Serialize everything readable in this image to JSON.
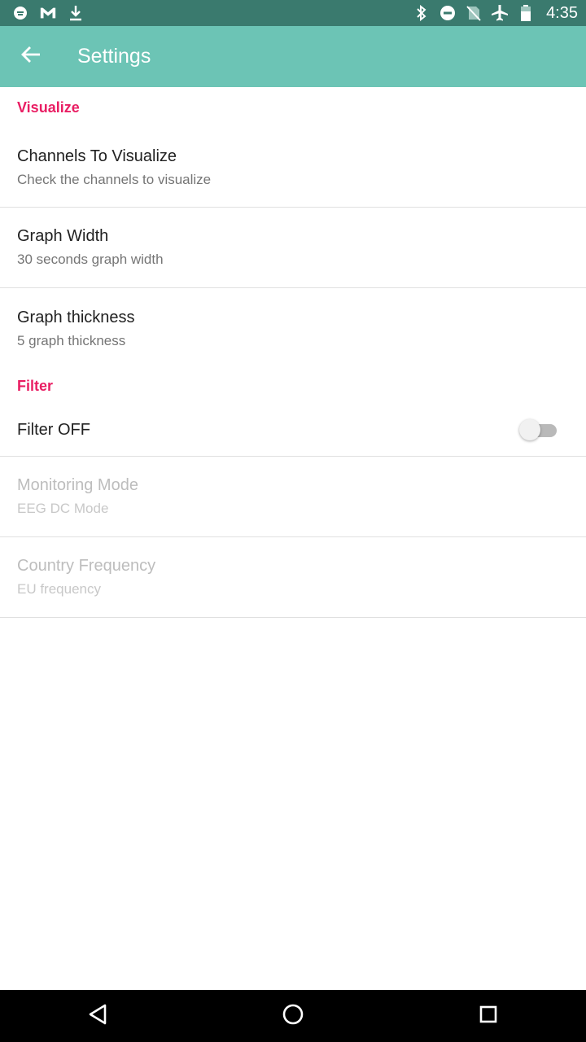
{
  "status_bar": {
    "time": "4:35",
    "left_icons": [
      "ghostery-icon",
      "gmail-icon",
      "download-icon"
    ],
    "right_icons": [
      "bluetooth-icon",
      "do-not-disturb-icon",
      "no-sim-icon",
      "airplane-mode-icon",
      "battery-icon"
    ]
  },
  "app_bar": {
    "title": "Settings",
    "background": "#6cc4b5"
  },
  "sections": {
    "visualize": {
      "header": "Visualize",
      "channels": {
        "title": "Channels To Visualize",
        "summary": "Check the channels to visualize"
      },
      "graph_width": {
        "title": "Graph Width",
        "summary": "30 seconds graph width"
      },
      "graph_thickness": {
        "title": "Graph thickness",
        "summary": "5 graph thickness"
      }
    },
    "filter": {
      "header": "Filter",
      "filter_toggle": {
        "title": "Filter OFF",
        "checked": false
      },
      "monitoring_mode": {
        "title": "Monitoring Mode",
        "summary": "EEG DC Mode",
        "enabled": false
      },
      "country_frequency": {
        "title": "Country Frequency",
        "summary": "EU frequency",
        "enabled": false
      }
    }
  },
  "colors": {
    "accent": "#e91e63",
    "status_bar": "#3a7a6e"
  }
}
